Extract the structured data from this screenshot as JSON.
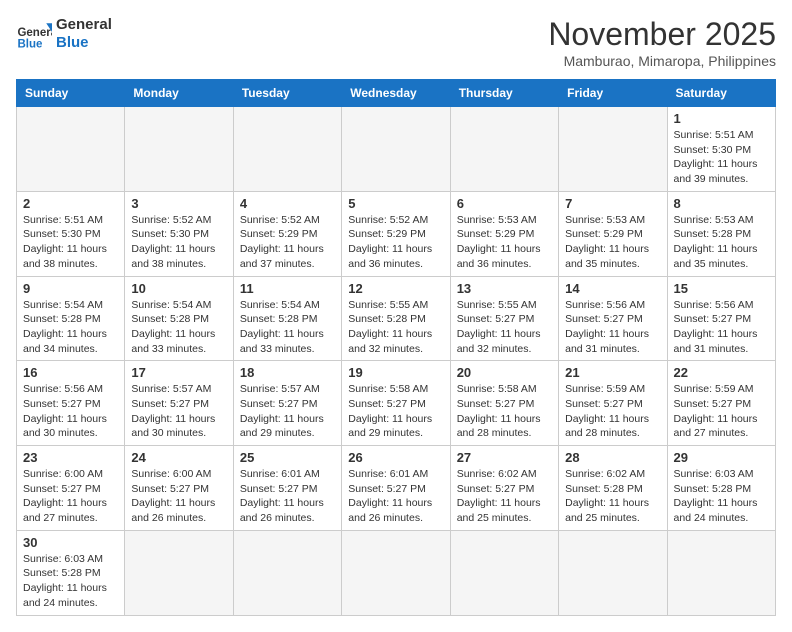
{
  "header": {
    "logo_general": "General",
    "logo_blue": "Blue",
    "month_title": "November 2025",
    "location": "Mamburao, Mimaropa, Philippines"
  },
  "weekdays": [
    "Sunday",
    "Monday",
    "Tuesday",
    "Wednesday",
    "Thursday",
    "Friday",
    "Saturday"
  ],
  "weeks": [
    [
      {
        "day": "",
        "info": ""
      },
      {
        "day": "",
        "info": ""
      },
      {
        "day": "",
        "info": ""
      },
      {
        "day": "",
        "info": ""
      },
      {
        "day": "",
        "info": ""
      },
      {
        "day": "",
        "info": ""
      },
      {
        "day": "1",
        "info": "Sunrise: 5:51 AM\nSunset: 5:30 PM\nDaylight: 11 hours and 39 minutes."
      }
    ],
    [
      {
        "day": "2",
        "info": "Sunrise: 5:51 AM\nSunset: 5:30 PM\nDaylight: 11 hours and 38 minutes."
      },
      {
        "day": "3",
        "info": "Sunrise: 5:52 AM\nSunset: 5:30 PM\nDaylight: 11 hours and 38 minutes."
      },
      {
        "day": "4",
        "info": "Sunrise: 5:52 AM\nSunset: 5:29 PM\nDaylight: 11 hours and 37 minutes."
      },
      {
        "day": "5",
        "info": "Sunrise: 5:52 AM\nSunset: 5:29 PM\nDaylight: 11 hours and 36 minutes."
      },
      {
        "day": "6",
        "info": "Sunrise: 5:53 AM\nSunset: 5:29 PM\nDaylight: 11 hours and 36 minutes."
      },
      {
        "day": "7",
        "info": "Sunrise: 5:53 AM\nSunset: 5:29 PM\nDaylight: 11 hours and 35 minutes."
      },
      {
        "day": "8",
        "info": "Sunrise: 5:53 AM\nSunset: 5:28 PM\nDaylight: 11 hours and 35 minutes."
      }
    ],
    [
      {
        "day": "9",
        "info": "Sunrise: 5:54 AM\nSunset: 5:28 PM\nDaylight: 11 hours and 34 minutes."
      },
      {
        "day": "10",
        "info": "Sunrise: 5:54 AM\nSunset: 5:28 PM\nDaylight: 11 hours and 33 minutes."
      },
      {
        "day": "11",
        "info": "Sunrise: 5:54 AM\nSunset: 5:28 PM\nDaylight: 11 hours and 33 minutes."
      },
      {
        "day": "12",
        "info": "Sunrise: 5:55 AM\nSunset: 5:28 PM\nDaylight: 11 hours and 32 minutes."
      },
      {
        "day": "13",
        "info": "Sunrise: 5:55 AM\nSunset: 5:27 PM\nDaylight: 11 hours and 32 minutes."
      },
      {
        "day": "14",
        "info": "Sunrise: 5:56 AM\nSunset: 5:27 PM\nDaylight: 11 hours and 31 minutes."
      },
      {
        "day": "15",
        "info": "Sunrise: 5:56 AM\nSunset: 5:27 PM\nDaylight: 11 hours and 31 minutes."
      }
    ],
    [
      {
        "day": "16",
        "info": "Sunrise: 5:56 AM\nSunset: 5:27 PM\nDaylight: 11 hours and 30 minutes."
      },
      {
        "day": "17",
        "info": "Sunrise: 5:57 AM\nSunset: 5:27 PM\nDaylight: 11 hours and 30 minutes."
      },
      {
        "day": "18",
        "info": "Sunrise: 5:57 AM\nSunset: 5:27 PM\nDaylight: 11 hours and 29 minutes."
      },
      {
        "day": "19",
        "info": "Sunrise: 5:58 AM\nSunset: 5:27 PM\nDaylight: 11 hours and 29 minutes."
      },
      {
        "day": "20",
        "info": "Sunrise: 5:58 AM\nSunset: 5:27 PM\nDaylight: 11 hours and 28 minutes."
      },
      {
        "day": "21",
        "info": "Sunrise: 5:59 AM\nSunset: 5:27 PM\nDaylight: 11 hours and 28 minutes."
      },
      {
        "day": "22",
        "info": "Sunrise: 5:59 AM\nSunset: 5:27 PM\nDaylight: 11 hours and 27 minutes."
      }
    ],
    [
      {
        "day": "23",
        "info": "Sunrise: 6:00 AM\nSunset: 5:27 PM\nDaylight: 11 hours and 27 minutes."
      },
      {
        "day": "24",
        "info": "Sunrise: 6:00 AM\nSunset: 5:27 PM\nDaylight: 11 hours and 26 minutes."
      },
      {
        "day": "25",
        "info": "Sunrise: 6:01 AM\nSunset: 5:27 PM\nDaylight: 11 hours and 26 minutes."
      },
      {
        "day": "26",
        "info": "Sunrise: 6:01 AM\nSunset: 5:27 PM\nDaylight: 11 hours and 26 minutes."
      },
      {
        "day": "27",
        "info": "Sunrise: 6:02 AM\nSunset: 5:27 PM\nDaylight: 11 hours and 25 minutes."
      },
      {
        "day": "28",
        "info": "Sunrise: 6:02 AM\nSunset: 5:28 PM\nDaylight: 11 hours and 25 minutes."
      },
      {
        "day": "29",
        "info": "Sunrise: 6:03 AM\nSunset: 5:28 PM\nDaylight: 11 hours and 24 minutes."
      }
    ],
    [
      {
        "day": "30",
        "info": "Sunrise: 6:03 AM\nSunset: 5:28 PM\nDaylight: 11 hours and 24 minutes."
      },
      {
        "day": "",
        "info": ""
      },
      {
        "day": "",
        "info": ""
      },
      {
        "day": "",
        "info": ""
      },
      {
        "day": "",
        "info": ""
      },
      {
        "day": "",
        "info": ""
      },
      {
        "day": "",
        "info": ""
      }
    ]
  ]
}
